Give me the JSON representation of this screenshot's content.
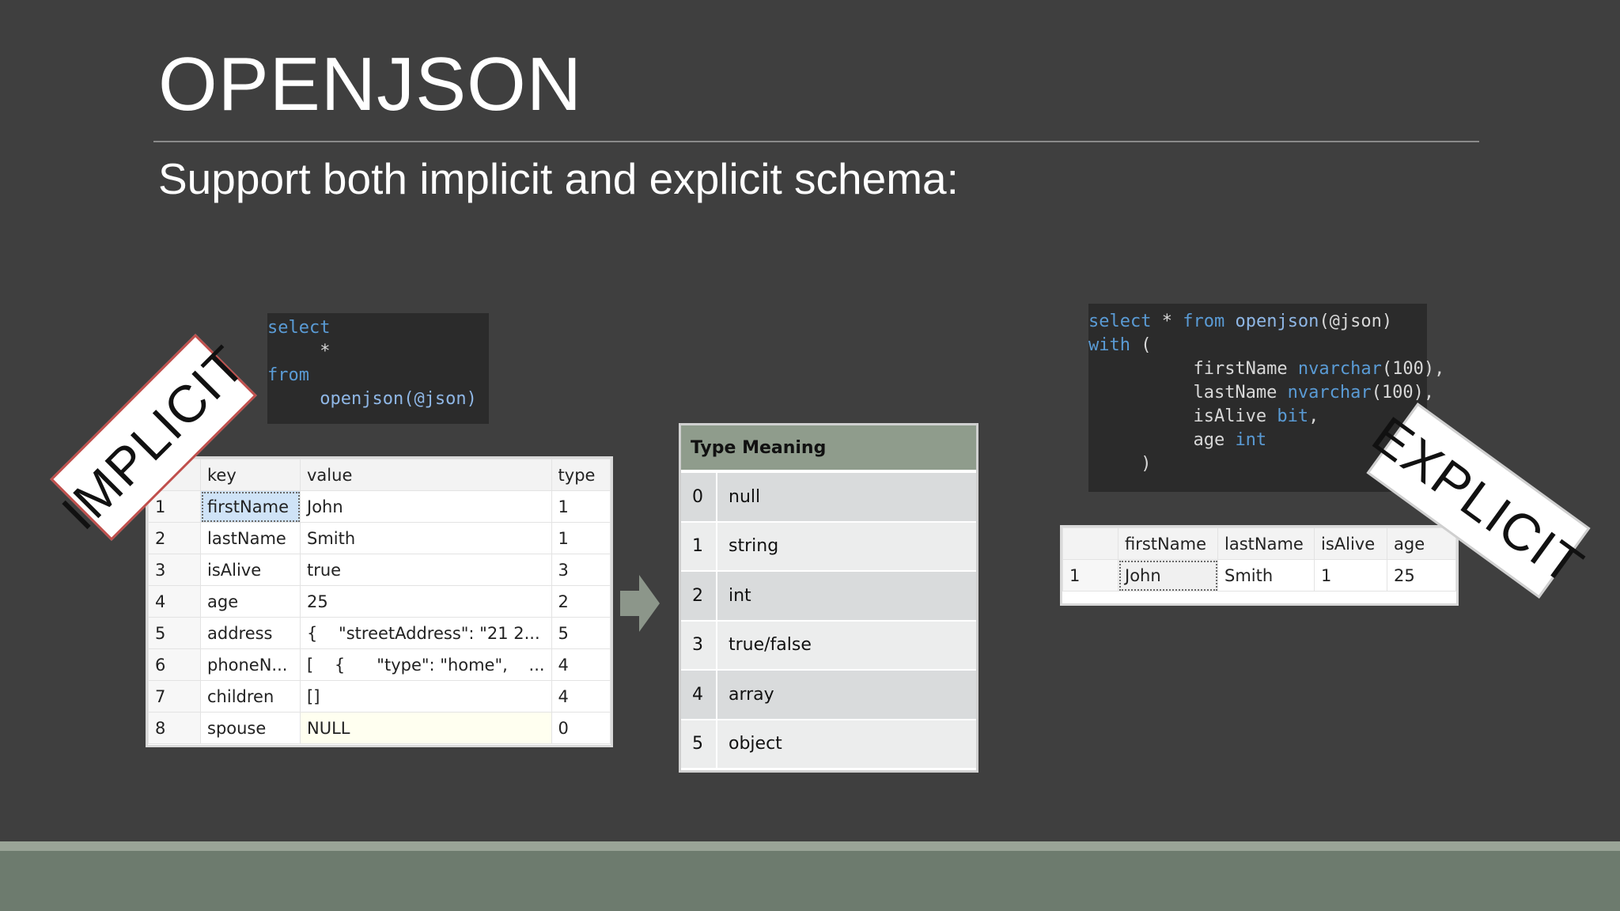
{
  "slide": {
    "title": "OPENJSON",
    "subtitle": "Support both implicit and explicit schema:"
  },
  "labels": {
    "implicit": "IMPLICIT",
    "explicit": "EXPLICIT"
  },
  "implicit_code": {
    "lines": [
      "select",
      "*",
      "from",
      "openjson(@json)"
    ]
  },
  "explicit_code": {
    "line1_kw1": "select",
    "line1_star": " * ",
    "line1_kw2": "from",
    "line1_fn": " openjson",
    "line1_rest": "(@json)",
    "line2": "with",
    "line2_rest": " (",
    "col1_name": "firstName ",
    "col1_type": "nvarchar",
    "col1_rest": "(100),",
    "col2_name": "lastName ",
    "col2_type": "nvarchar",
    "col2_rest": "(100),",
    "col3_name": "isAlive ",
    "col3_type": "bit",
    "col3_rest": ",",
    "col4_name": "age ",
    "col4_type": "int",
    "close": ")"
  },
  "implicit_grid": {
    "headers": [
      "",
      "key",
      "value",
      "type"
    ],
    "rows": [
      [
        "1",
        "firstName",
        "John",
        "1"
      ],
      [
        "2",
        "lastName",
        "Smith",
        "1"
      ],
      [
        "3",
        "isAlive",
        "true",
        "3"
      ],
      [
        "4",
        "age",
        "25",
        "2"
      ],
      [
        "5",
        "address",
        "{    \"streetAddress\": \"21 2...",
        "5"
      ],
      [
        "6",
        "phoneN...",
        "[    {      \"type\": \"home\",    ...",
        "4"
      ],
      [
        "7",
        "children",
        "[]",
        "4"
      ],
      [
        "8",
        "spouse",
        "NULL",
        "0"
      ]
    ]
  },
  "type_table": {
    "header": "Type Meaning",
    "rows": [
      [
        "0",
        "null"
      ],
      [
        "1",
        "string"
      ],
      [
        "2",
        "int"
      ],
      [
        "3",
        "true/false"
      ],
      [
        "4",
        "array"
      ],
      [
        "5",
        "object"
      ]
    ]
  },
  "explicit_grid": {
    "headers": [
      "",
      "firstName",
      "lastName",
      "isAlive",
      "age"
    ],
    "rows": [
      [
        "1",
        "John",
        "Smith",
        "1",
        "25"
      ]
    ]
  },
  "colors": {
    "background": "#3f3f3f",
    "keyword": "#5a9bd5",
    "type_header": "#8f9c8c",
    "footer": "#6d7b6e",
    "implicit_border": "#c0504d"
  },
  "icons": {
    "arrow": "right-arrow-icon"
  }
}
